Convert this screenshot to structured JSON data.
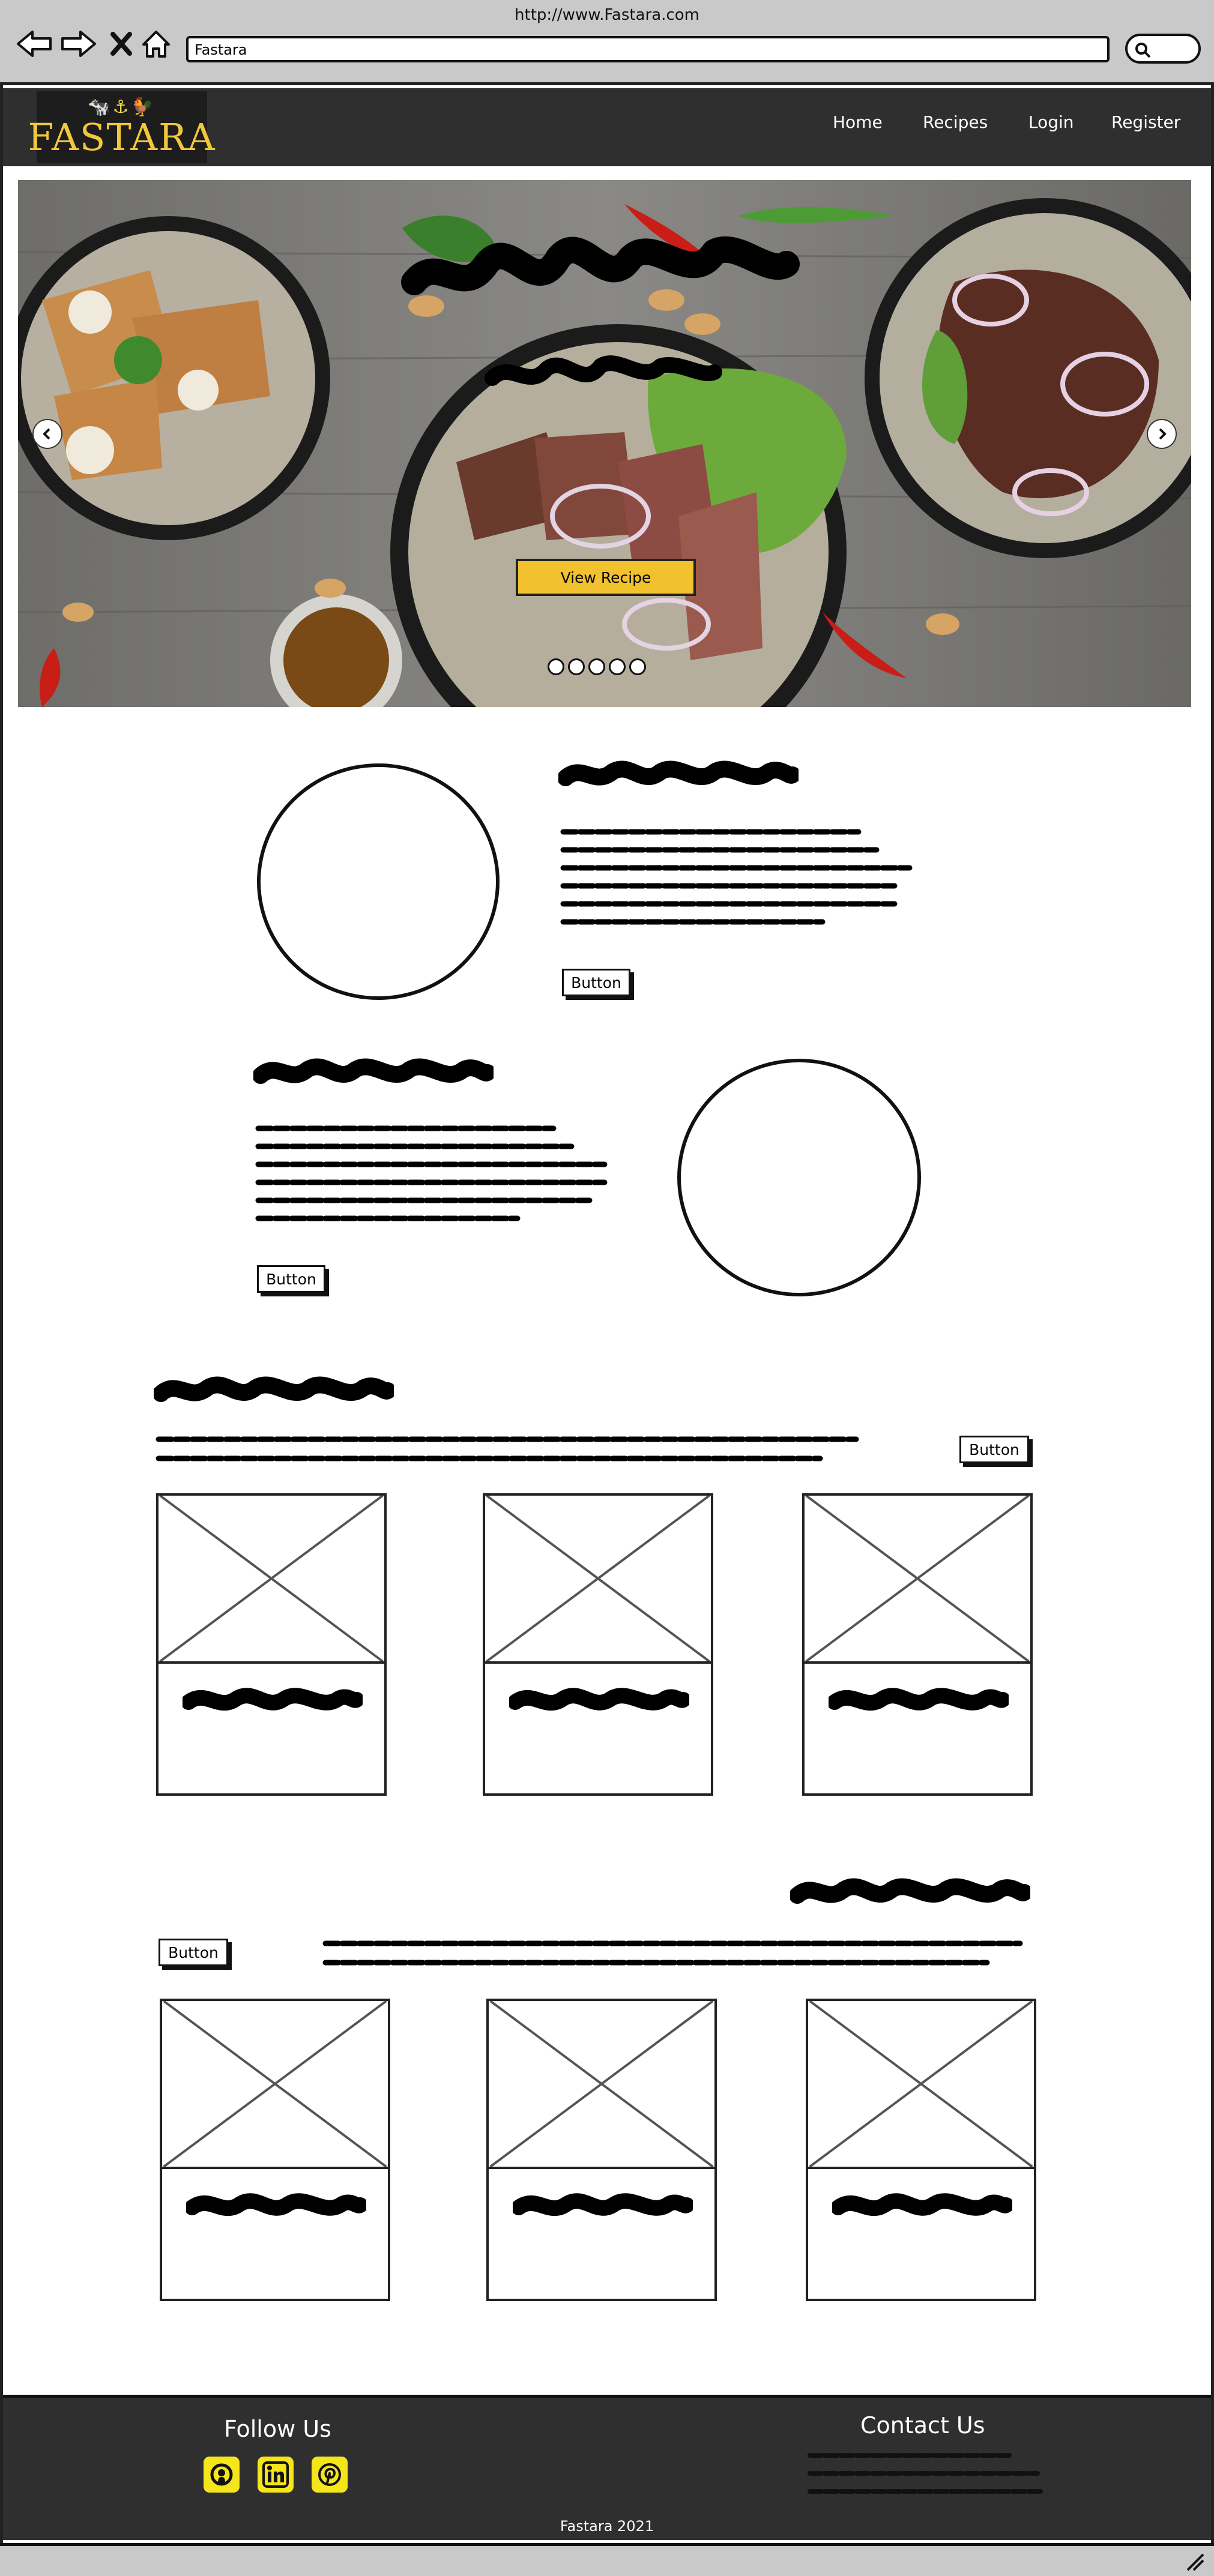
{
  "browser": {
    "url_title": "http://www.Fastara.com",
    "address_text": "Fastara",
    "icons": [
      "back-arrow-icon",
      "forward-arrow-icon",
      "close-icon",
      "home-icon",
      "search-icon"
    ]
  },
  "header": {
    "logo_glyphs": "🐄⚓🐓",
    "logo_text": "FASTARA",
    "nav": [
      "Home",
      "Recipes",
      "Login",
      "Register"
    ]
  },
  "hero": {
    "button_label": "View Recipe",
    "carousel_dots": 5,
    "accent_color": "#f2c12e"
  },
  "features": {
    "button_1": "Button",
    "button_2": "Button"
  },
  "recipes_section_1": {
    "button": "Button",
    "cards": 3
  },
  "recipes_section_2": {
    "button": "Button",
    "cards": 3
  },
  "footer": {
    "follow_title": "Follow Us",
    "contact_title": "Contact Us",
    "social_icons": [
      "github-icon",
      "linkedin-icon",
      "pinterest-icon"
    ],
    "copyright": "Fastara 2021",
    "social_color": "#f5e51b"
  }
}
